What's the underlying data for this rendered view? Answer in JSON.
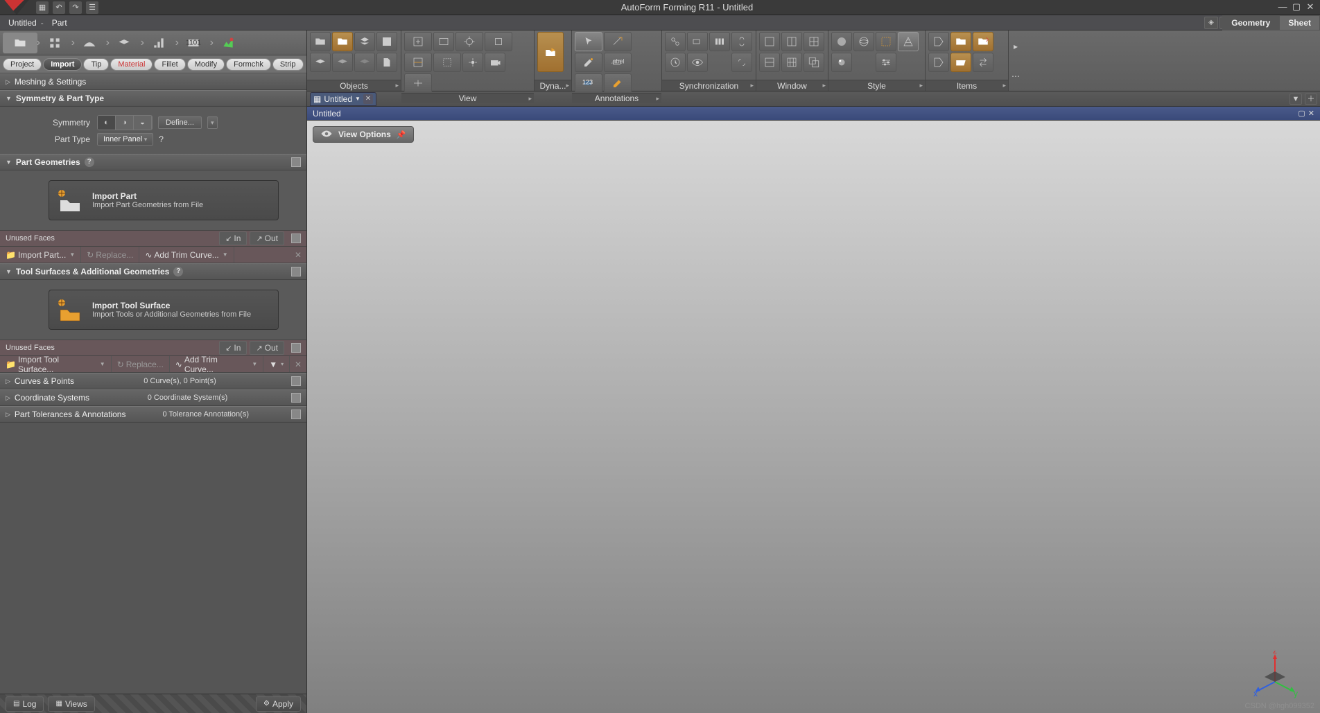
{
  "app": {
    "title": "AutoForm Forming R11 - Untitled"
  },
  "breadcrumb": {
    "a": "Untitled",
    "b": "Part"
  },
  "toptabs": {
    "geometry": "Geometry",
    "sheet": "Sheet"
  },
  "tabs": {
    "project": "Project",
    "import": "Import",
    "tip": "Tip",
    "material": "Material",
    "fillet": "Fillet",
    "modify": "Modify",
    "formchk": "Formchk",
    "strip": "Strip"
  },
  "sections": {
    "meshing": "Meshing & Settings",
    "symmetry": "Symmetry & Part Type",
    "partgeom": "Part Geometries",
    "toolsurf": "Tool Surfaces & Additional Geometries",
    "curves": "Curves & Points",
    "curves_info": "0 Curve(s), 0 Point(s)",
    "coord": "Coordinate Systems",
    "coord_info": "0 Coordinate System(s)",
    "tol": "Part Tolerances & Annotations",
    "tol_info": "0 Tolerance Annotation(s)"
  },
  "form": {
    "symmetry_lbl": "Symmetry",
    "define": "Define...",
    "parttype_lbl": "Part Type",
    "parttype_val": "Inner Panel"
  },
  "importpart": {
    "title": "Import Part",
    "desc": "Import Part Geometries from File"
  },
  "importtool": {
    "title": "Import Tool Surface",
    "desc": "Import Tools or Additional Geometries from File"
  },
  "unused": {
    "label": "Unused Faces",
    "in": "In",
    "out": "Out"
  },
  "tb1": {
    "a": "Import Part...",
    "b": "Replace...",
    "c": "Add Trim Curve..."
  },
  "tb2": {
    "a": "Import Tool Surface...",
    "b": "Replace...",
    "c": "Add Trim Curve..."
  },
  "bottom": {
    "log": "Log",
    "views": "Views",
    "apply": "Apply"
  },
  "ribbon": {
    "objects": "Objects",
    "view": "View",
    "dyna": "Dyna...",
    "ann": "Annotations",
    "sync": "Synchronization",
    "window": "Window",
    "style": "Style",
    "items": "Items"
  },
  "doctab": {
    "name": "Untitled"
  },
  "subtitle": "Untitled",
  "viewopt": "View Options",
  "watermark": "CSDN @hgh099352"
}
